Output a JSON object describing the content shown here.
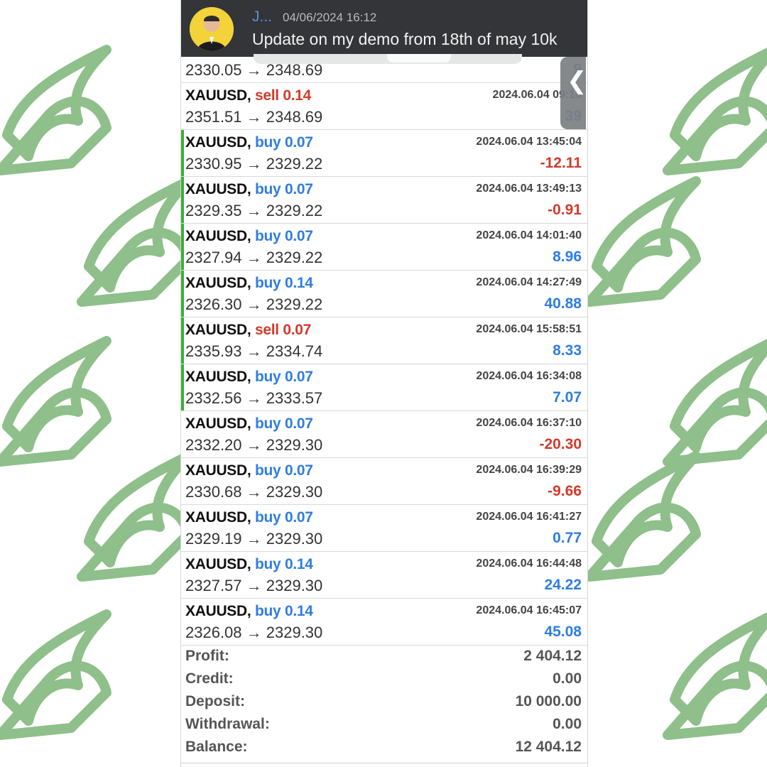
{
  "chat": {
    "sender": "J...",
    "timestamp": "04/06/2024 16:12",
    "message": "Update on my demo from 18th of may 10k"
  },
  "colors": {
    "buy": "#2f7de1",
    "sell": "#d23a2a",
    "positive": "#2f7de1",
    "negative": "#d23a2a",
    "highlight_bar": "#3cae3c",
    "background_pattern": "#8fbf8a"
  },
  "icons": {
    "side_tab": "chevron-left-icon",
    "pattern": "green-curl-logo"
  },
  "partial_row": {
    "prices": "2330.05 → 2348.69",
    "profit": "9"
  },
  "trades": [
    {
      "symbol": "XAUUSD,",
      "action": "sell",
      "volume": "0.14",
      "time": "2024.06.04 09:16",
      "prices": "2351.51 → 2348.69",
      "profit": "39",
      "positive": true,
      "highlighted": false
    },
    {
      "symbol": "XAUUSD,",
      "action": "buy",
      "volume": "0.07",
      "time": "2024.06.04 13:45:04",
      "prices": "2330.95 → 2329.22",
      "profit": "-12.11",
      "positive": false,
      "highlighted": true
    },
    {
      "symbol": "XAUUSD,",
      "action": "buy",
      "volume": "0.07",
      "time": "2024.06.04 13:49:13",
      "prices": "2329.35 → 2329.22",
      "profit": "-0.91",
      "positive": false,
      "highlighted": true
    },
    {
      "symbol": "XAUUSD,",
      "action": "buy",
      "volume": "0.07",
      "time": "2024.06.04 14:01:40",
      "prices": "2327.94 → 2329.22",
      "profit": "8.96",
      "positive": true,
      "highlighted": true
    },
    {
      "symbol": "XAUUSD,",
      "action": "buy",
      "volume": "0.14",
      "time": "2024.06.04 14:27:49",
      "prices": "2326.30 → 2329.22",
      "profit": "40.88",
      "positive": true,
      "highlighted": true
    },
    {
      "symbol": "XAUUSD,",
      "action": "sell",
      "volume": "0.07",
      "time": "2024.06.04 15:58:51",
      "prices": "2335.93 → 2334.74",
      "profit": "8.33",
      "positive": true,
      "highlighted": true
    },
    {
      "symbol": "XAUUSD,",
      "action": "buy",
      "volume": "0.07",
      "time": "2024.06.04 16:34:08",
      "prices": "2332.56 → 2333.57",
      "profit": "7.07",
      "positive": true,
      "highlighted": true
    },
    {
      "symbol": "XAUUSD,",
      "action": "buy",
      "volume": "0.07",
      "time": "2024.06.04 16:37:10",
      "prices": "2332.20 → 2329.30",
      "profit": "-20.30",
      "positive": false,
      "highlighted": false
    },
    {
      "symbol": "XAUUSD,",
      "action": "buy",
      "volume": "0.07",
      "time": "2024.06.04 16:39:29",
      "prices": "2330.68 → 2329.30",
      "profit": "-9.66",
      "positive": false,
      "highlighted": false
    },
    {
      "symbol": "XAUUSD,",
      "action": "buy",
      "volume": "0.07",
      "time": "2024.06.04 16:41:27",
      "prices": "2329.19 → 2329.30",
      "profit": "0.77",
      "positive": true,
      "highlighted": false
    },
    {
      "symbol": "XAUUSD,",
      "action": "buy",
      "volume": "0.14",
      "time": "2024.06.04 16:44:48",
      "prices": "2327.57 → 2329.30",
      "profit": "24.22",
      "positive": true,
      "highlighted": false
    },
    {
      "symbol": "XAUUSD,",
      "action": "buy",
      "volume": "0.14",
      "time": "2024.06.04 16:45:07",
      "prices": "2326.08 → 2329.30",
      "profit": "45.08",
      "positive": true,
      "highlighted": false
    }
  ],
  "summary": [
    {
      "label": "Profit:",
      "value": "2 404.12"
    },
    {
      "label": "Credit:",
      "value": "0.00"
    },
    {
      "label": "Deposit:",
      "value": "10 000.00"
    },
    {
      "label": "Withdrawal:",
      "value": "0.00"
    },
    {
      "label": "Balance:",
      "value": "12 404.12"
    }
  ]
}
